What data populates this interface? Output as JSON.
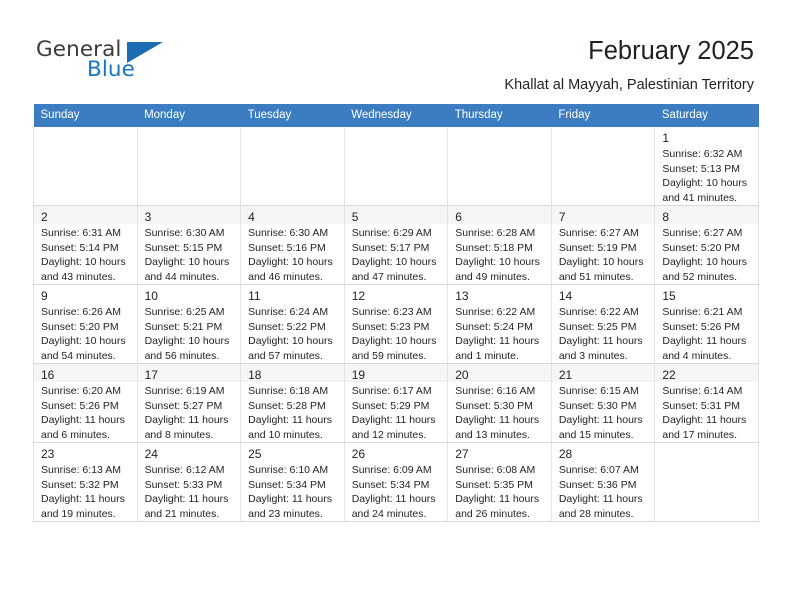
{
  "brand": {
    "name_part1": "General",
    "name_part2": "Blue",
    "triangle_icon": "blue-triangle-logo-mark",
    "accent_color": "#1b75bb"
  },
  "header": {
    "title": "February 2025",
    "subtitle": "Khallat al Mayyah, Palestinian Territory"
  },
  "calendar": {
    "header_bg": "#3b7dc0",
    "weekdays": [
      "Sunday",
      "Monday",
      "Tuesday",
      "Wednesday",
      "Thursday",
      "Friday",
      "Saturday"
    ],
    "weeks": [
      [
        {
          "day": "",
          "sunrise": "",
          "sunset": "",
          "daylight": "",
          "empty": true
        },
        {
          "day": "",
          "sunrise": "",
          "sunset": "",
          "daylight": "",
          "empty": true
        },
        {
          "day": "",
          "sunrise": "",
          "sunset": "",
          "daylight": "",
          "empty": true
        },
        {
          "day": "",
          "sunrise": "",
          "sunset": "",
          "daylight": "",
          "empty": true
        },
        {
          "day": "",
          "sunrise": "",
          "sunset": "",
          "daylight": "",
          "empty": true
        },
        {
          "day": "",
          "sunrise": "",
          "sunset": "",
          "daylight": "",
          "empty": true
        },
        {
          "day": "1",
          "sunrise": "Sunrise: 6:32 AM",
          "sunset": "Sunset: 5:13 PM",
          "daylight": "Daylight: 10 hours and 41 minutes.",
          "empty": false
        }
      ],
      [
        {
          "day": "2",
          "sunrise": "Sunrise: 6:31 AM",
          "sunset": "Sunset: 5:14 PM",
          "daylight": "Daylight: 10 hours and 43 minutes.",
          "empty": false
        },
        {
          "day": "3",
          "sunrise": "Sunrise: 6:30 AM",
          "sunset": "Sunset: 5:15 PM",
          "daylight": "Daylight: 10 hours and 44 minutes.",
          "empty": false
        },
        {
          "day": "4",
          "sunrise": "Sunrise: 6:30 AM",
          "sunset": "Sunset: 5:16 PM",
          "daylight": "Daylight: 10 hours and 46 minutes.",
          "empty": false
        },
        {
          "day": "5",
          "sunrise": "Sunrise: 6:29 AM",
          "sunset": "Sunset: 5:17 PM",
          "daylight": "Daylight: 10 hours and 47 minutes.",
          "empty": false
        },
        {
          "day": "6",
          "sunrise": "Sunrise: 6:28 AM",
          "sunset": "Sunset: 5:18 PM",
          "daylight": "Daylight: 10 hours and 49 minutes.",
          "empty": false
        },
        {
          "day": "7",
          "sunrise": "Sunrise: 6:27 AM",
          "sunset": "Sunset: 5:19 PM",
          "daylight": "Daylight: 10 hours and 51 minutes.",
          "empty": false
        },
        {
          "day": "8",
          "sunrise": "Sunrise: 6:27 AM",
          "sunset": "Sunset: 5:20 PM",
          "daylight": "Daylight: 10 hours and 52 minutes.",
          "empty": false
        }
      ],
      [
        {
          "day": "9",
          "sunrise": "Sunrise: 6:26 AM",
          "sunset": "Sunset: 5:20 PM",
          "daylight": "Daylight: 10 hours and 54 minutes.",
          "empty": false
        },
        {
          "day": "10",
          "sunrise": "Sunrise: 6:25 AM",
          "sunset": "Sunset: 5:21 PM",
          "daylight": "Daylight: 10 hours and 56 minutes.",
          "empty": false
        },
        {
          "day": "11",
          "sunrise": "Sunrise: 6:24 AM",
          "sunset": "Sunset: 5:22 PM",
          "daylight": "Daylight: 10 hours and 57 minutes.",
          "empty": false
        },
        {
          "day": "12",
          "sunrise": "Sunrise: 6:23 AM",
          "sunset": "Sunset: 5:23 PM",
          "daylight": "Daylight: 10 hours and 59 minutes.",
          "empty": false
        },
        {
          "day": "13",
          "sunrise": "Sunrise: 6:22 AM",
          "sunset": "Sunset: 5:24 PM",
          "daylight": "Daylight: 11 hours and 1 minute.",
          "empty": false
        },
        {
          "day": "14",
          "sunrise": "Sunrise: 6:22 AM",
          "sunset": "Sunset: 5:25 PM",
          "daylight": "Daylight: 11 hours and 3 minutes.",
          "empty": false
        },
        {
          "day": "15",
          "sunrise": "Sunrise: 6:21 AM",
          "sunset": "Sunset: 5:26 PM",
          "daylight": "Daylight: 11 hours and 4 minutes.",
          "empty": false
        }
      ],
      [
        {
          "day": "16",
          "sunrise": "Sunrise: 6:20 AM",
          "sunset": "Sunset: 5:26 PM",
          "daylight": "Daylight: 11 hours and 6 minutes.",
          "empty": false
        },
        {
          "day": "17",
          "sunrise": "Sunrise: 6:19 AM",
          "sunset": "Sunset: 5:27 PM",
          "daylight": "Daylight: 11 hours and 8 minutes.",
          "empty": false
        },
        {
          "day": "18",
          "sunrise": "Sunrise: 6:18 AM",
          "sunset": "Sunset: 5:28 PM",
          "daylight": "Daylight: 11 hours and 10 minutes.",
          "empty": false
        },
        {
          "day": "19",
          "sunrise": "Sunrise: 6:17 AM",
          "sunset": "Sunset: 5:29 PM",
          "daylight": "Daylight: 11 hours and 12 minutes.",
          "empty": false
        },
        {
          "day": "20",
          "sunrise": "Sunrise: 6:16 AM",
          "sunset": "Sunset: 5:30 PM",
          "daylight": "Daylight: 11 hours and 13 minutes.",
          "empty": false
        },
        {
          "day": "21",
          "sunrise": "Sunrise: 6:15 AM",
          "sunset": "Sunset: 5:30 PM",
          "daylight": "Daylight: 11 hours and 15 minutes.",
          "empty": false
        },
        {
          "day": "22",
          "sunrise": "Sunrise: 6:14 AM",
          "sunset": "Sunset: 5:31 PM",
          "daylight": "Daylight: 11 hours and 17 minutes.",
          "empty": false
        }
      ],
      [
        {
          "day": "23",
          "sunrise": "Sunrise: 6:13 AM",
          "sunset": "Sunset: 5:32 PM",
          "daylight": "Daylight: 11 hours and 19 minutes.",
          "empty": false
        },
        {
          "day": "24",
          "sunrise": "Sunrise: 6:12 AM",
          "sunset": "Sunset: 5:33 PM",
          "daylight": "Daylight: 11 hours and 21 minutes.",
          "empty": false
        },
        {
          "day": "25",
          "sunrise": "Sunrise: 6:10 AM",
          "sunset": "Sunset: 5:34 PM",
          "daylight": "Daylight: 11 hours and 23 minutes.",
          "empty": false
        },
        {
          "day": "26",
          "sunrise": "Sunrise: 6:09 AM",
          "sunset": "Sunset: 5:34 PM",
          "daylight": "Daylight: 11 hours and 24 minutes.",
          "empty": false
        },
        {
          "day": "27",
          "sunrise": "Sunrise: 6:08 AM",
          "sunset": "Sunset: 5:35 PM",
          "daylight": "Daylight: 11 hours and 26 minutes.",
          "empty": false
        },
        {
          "day": "28",
          "sunrise": "Sunrise: 6:07 AM",
          "sunset": "Sunset: 5:36 PM",
          "daylight": "Daylight: 11 hours and 28 minutes.",
          "empty": false
        },
        {
          "day": "",
          "sunrise": "",
          "sunset": "",
          "daylight": "",
          "empty": true
        }
      ]
    ]
  }
}
